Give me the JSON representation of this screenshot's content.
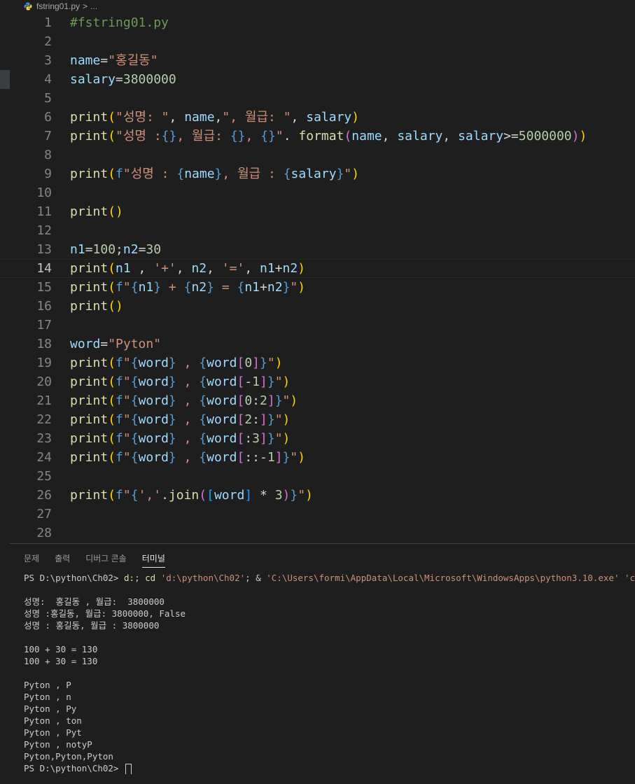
{
  "breadcrumb": {
    "file": "fstring01.py",
    "separator": ">",
    "trail": "..."
  },
  "editor": {
    "active_line": 14,
    "lines": [
      {
        "n": "1",
        "t": [
          [
            "c-comment",
            "#fstring01.py"
          ]
        ]
      },
      {
        "n": "2",
        "t": []
      },
      {
        "n": "3",
        "t": [
          [
            "c-var",
            "name"
          ],
          [
            "c-op",
            "="
          ],
          [
            "c-str",
            "\"홍길동\""
          ]
        ]
      },
      {
        "n": "4",
        "t": [
          [
            "c-var",
            "salary"
          ],
          [
            "c-op",
            "="
          ],
          [
            "c-num",
            "3800000"
          ]
        ]
      },
      {
        "n": "5",
        "t": []
      },
      {
        "n": "6",
        "t": [
          [
            "c-fn",
            "print"
          ],
          [
            "c-br1",
            "("
          ],
          [
            "c-str",
            "\"성명: \""
          ],
          [
            "c-op",
            ", "
          ],
          [
            "c-var",
            "name"
          ],
          [
            "c-op",
            ","
          ],
          [
            "c-str",
            "\", 월급: \""
          ],
          [
            "c-op",
            ", "
          ],
          [
            "c-var",
            "salary"
          ],
          [
            "c-br1",
            ")"
          ]
        ]
      },
      {
        "n": "7",
        "t": [
          [
            "c-fn",
            "print"
          ],
          [
            "c-br1",
            "("
          ],
          [
            "c-str",
            "\"성명 :"
          ],
          [
            "c-kw",
            "{}"
          ],
          [
            "c-str",
            ", 월급: "
          ],
          [
            "c-kw",
            "{}"
          ],
          [
            "c-str",
            ", "
          ],
          [
            "c-kw",
            "{}"
          ],
          [
            "c-str",
            "\""
          ],
          [
            "c-op",
            ". "
          ],
          [
            "c-fn",
            "format"
          ],
          [
            "c-br2",
            "("
          ],
          [
            "c-var",
            "name"
          ],
          [
            "c-op",
            ", "
          ],
          [
            "c-var",
            "salary"
          ],
          [
            "c-op",
            ", "
          ],
          [
            "c-var",
            "salary"
          ],
          [
            "c-op",
            ">="
          ],
          [
            "c-num",
            "5000000"
          ],
          [
            "c-br2",
            ")"
          ],
          [
            "c-br1",
            ")"
          ]
        ]
      },
      {
        "n": "8",
        "t": []
      },
      {
        "n": "9",
        "t": [
          [
            "c-fn",
            "print"
          ],
          [
            "c-br1",
            "("
          ],
          [
            "c-kw",
            "f"
          ],
          [
            "c-str",
            "\"성명 : "
          ],
          [
            "c-kw",
            "{"
          ],
          [
            "c-var",
            "name"
          ],
          [
            "c-kw",
            "}"
          ],
          [
            "c-str",
            ", 월급 : "
          ],
          [
            "c-kw",
            "{"
          ],
          [
            "c-var",
            "salary"
          ],
          [
            "c-kw",
            "}"
          ],
          [
            "c-str",
            "\""
          ],
          [
            "c-br1",
            ")"
          ]
        ]
      },
      {
        "n": "10",
        "t": []
      },
      {
        "n": "11",
        "t": [
          [
            "c-fn",
            "print"
          ],
          [
            "c-br1",
            "()"
          ]
        ]
      },
      {
        "n": "12",
        "t": []
      },
      {
        "n": "13",
        "t": [
          [
            "c-var",
            "n1"
          ],
          [
            "c-op",
            "="
          ],
          [
            "c-num",
            "100"
          ],
          [
            "c-op",
            ";"
          ],
          [
            "c-var",
            "n2"
          ],
          [
            "c-op",
            "="
          ],
          [
            "c-num",
            "30"
          ]
        ]
      },
      {
        "n": "14",
        "t": [
          [
            "c-fn",
            "print"
          ],
          [
            "c-br1",
            "("
          ],
          [
            "c-var",
            "n1"
          ],
          [
            "c-op",
            " , "
          ],
          [
            "c-str",
            "'+'"
          ],
          [
            "c-op",
            ", "
          ],
          [
            "c-var",
            "n2"
          ],
          [
            "c-op",
            ", "
          ],
          [
            "c-str",
            "'='"
          ],
          [
            "c-op",
            ", "
          ],
          [
            "c-var",
            "n1"
          ],
          [
            "c-op",
            "+"
          ],
          [
            "c-var",
            "n2"
          ],
          [
            "c-br1",
            ")"
          ]
        ]
      },
      {
        "n": "15",
        "t": [
          [
            "c-fn",
            "print"
          ],
          [
            "c-br1",
            "("
          ],
          [
            "c-kw",
            "f"
          ],
          [
            "c-str",
            "\""
          ],
          [
            "c-kw",
            "{"
          ],
          [
            "c-var",
            "n1"
          ],
          [
            "c-kw",
            "}"
          ],
          [
            "c-str",
            " + "
          ],
          [
            "c-kw",
            "{"
          ],
          [
            "c-var",
            "n2"
          ],
          [
            "c-kw",
            "}"
          ],
          [
            "c-str",
            " = "
          ],
          [
            "c-kw",
            "{"
          ],
          [
            "c-var",
            "n1"
          ],
          [
            "c-op",
            "+"
          ],
          [
            "c-var",
            "n2"
          ],
          [
            "c-kw",
            "}"
          ],
          [
            "c-str",
            "\""
          ],
          [
            "c-br1",
            ")"
          ]
        ]
      },
      {
        "n": "16",
        "t": [
          [
            "c-fn",
            "print"
          ],
          [
            "c-br1",
            "()"
          ]
        ]
      },
      {
        "n": "17",
        "t": []
      },
      {
        "n": "18",
        "t": [
          [
            "c-var",
            "word"
          ],
          [
            "c-op",
            "="
          ],
          [
            "c-str",
            "\"Pyton\""
          ]
        ]
      },
      {
        "n": "19",
        "t": [
          [
            "c-fn",
            "print"
          ],
          [
            "c-br1",
            "("
          ],
          [
            "c-kw",
            "f"
          ],
          [
            "c-str",
            "\""
          ],
          [
            "c-kw",
            "{"
          ],
          [
            "c-var",
            "word"
          ],
          [
            "c-kw",
            "}"
          ],
          [
            "c-str",
            " , "
          ],
          [
            "c-kw",
            "{"
          ],
          [
            "c-var",
            "word"
          ],
          [
            "c-br2",
            "["
          ],
          [
            "c-num",
            "0"
          ],
          [
            "c-br2",
            "]"
          ],
          [
            "c-kw",
            "}"
          ],
          [
            "c-str",
            "\""
          ],
          [
            "c-br1",
            ")"
          ]
        ]
      },
      {
        "n": "20",
        "t": [
          [
            "c-fn",
            "print"
          ],
          [
            "c-br1",
            "("
          ],
          [
            "c-kw",
            "f"
          ],
          [
            "c-str",
            "\""
          ],
          [
            "c-kw",
            "{"
          ],
          [
            "c-var",
            "word"
          ],
          [
            "c-kw",
            "}"
          ],
          [
            "c-str",
            " , "
          ],
          [
            "c-kw",
            "{"
          ],
          [
            "c-var",
            "word"
          ],
          [
            "c-br2",
            "["
          ],
          [
            "c-op",
            "-"
          ],
          [
            "c-num",
            "1"
          ],
          [
            "c-br2",
            "]"
          ],
          [
            "c-kw",
            "}"
          ],
          [
            "c-str",
            "\""
          ],
          [
            "c-br1",
            ")"
          ]
        ]
      },
      {
        "n": "21",
        "t": [
          [
            "c-fn",
            "print"
          ],
          [
            "c-br1",
            "("
          ],
          [
            "c-kw",
            "f"
          ],
          [
            "c-str",
            "\""
          ],
          [
            "c-kw",
            "{"
          ],
          [
            "c-var",
            "word"
          ],
          [
            "c-kw",
            "}"
          ],
          [
            "c-str",
            " , "
          ],
          [
            "c-kw",
            "{"
          ],
          [
            "c-var",
            "word"
          ],
          [
            "c-br2",
            "["
          ],
          [
            "c-num",
            "0"
          ],
          [
            "c-op",
            ":"
          ],
          [
            "c-num",
            "2"
          ],
          [
            "c-br2",
            "]"
          ],
          [
            "c-kw",
            "}"
          ],
          [
            "c-str",
            "\""
          ],
          [
            "c-br1",
            ")"
          ]
        ]
      },
      {
        "n": "22",
        "t": [
          [
            "c-fn",
            "print"
          ],
          [
            "c-br1",
            "("
          ],
          [
            "c-kw",
            "f"
          ],
          [
            "c-str",
            "\""
          ],
          [
            "c-kw",
            "{"
          ],
          [
            "c-var",
            "word"
          ],
          [
            "c-kw",
            "}"
          ],
          [
            "c-str",
            " , "
          ],
          [
            "c-kw",
            "{"
          ],
          [
            "c-var",
            "word"
          ],
          [
            "c-br2",
            "["
          ],
          [
            "c-num",
            "2"
          ],
          [
            "c-op",
            ":"
          ],
          [
            "c-br2",
            "]"
          ],
          [
            "c-kw",
            "}"
          ],
          [
            "c-str",
            "\""
          ],
          [
            "c-br1",
            ")"
          ]
        ]
      },
      {
        "n": "23",
        "t": [
          [
            "c-fn",
            "print"
          ],
          [
            "c-br1",
            "("
          ],
          [
            "c-kw",
            "f"
          ],
          [
            "c-str",
            "\""
          ],
          [
            "c-kw",
            "{"
          ],
          [
            "c-var",
            "word"
          ],
          [
            "c-kw",
            "}"
          ],
          [
            "c-str",
            " , "
          ],
          [
            "c-kw",
            "{"
          ],
          [
            "c-var",
            "word"
          ],
          [
            "c-br2",
            "["
          ],
          [
            "c-op",
            ":"
          ],
          [
            "c-num",
            "3"
          ],
          [
            "c-br2",
            "]"
          ],
          [
            "c-kw",
            "}"
          ],
          [
            "c-str",
            "\""
          ],
          [
            "c-br1",
            ")"
          ]
        ]
      },
      {
        "n": "24",
        "t": [
          [
            "c-fn",
            "print"
          ],
          [
            "c-br1",
            "("
          ],
          [
            "c-kw",
            "f"
          ],
          [
            "c-str",
            "\""
          ],
          [
            "c-kw",
            "{"
          ],
          [
            "c-var",
            "word"
          ],
          [
            "c-kw",
            "}"
          ],
          [
            "c-str",
            " , "
          ],
          [
            "c-kw",
            "{"
          ],
          [
            "c-var",
            "word"
          ],
          [
            "c-br2",
            "["
          ],
          [
            "c-op",
            "::-"
          ],
          [
            "c-num",
            "1"
          ],
          [
            "c-br2",
            "]"
          ],
          [
            "c-kw",
            "}"
          ],
          [
            "c-str",
            "\""
          ],
          [
            "c-br1",
            ")"
          ]
        ]
      },
      {
        "n": "25",
        "t": []
      },
      {
        "n": "26",
        "t": [
          [
            "c-fn",
            "print"
          ],
          [
            "c-br1",
            "("
          ],
          [
            "c-kw",
            "f"
          ],
          [
            "c-str",
            "\""
          ],
          [
            "c-kw",
            "{"
          ],
          [
            "c-str",
            "','"
          ],
          [
            "c-op",
            "."
          ],
          [
            "c-fn",
            "join"
          ],
          [
            "c-br2",
            "("
          ],
          [
            "c-br3",
            "["
          ],
          [
            "c-var",
            "word"
          ],
          [
            "c-br3",
            "]"
          ],
          [
            "c-op",
            " * "
          ],
          [
            "c-num",
            "3"
          ],
          [
            "c-br2",
            ")"
          ],
          [
            "c-kw",
            "}"
          ],
          [
            "c-str",
            "\""
          ],
          [
            "c-br1",
            ")"
          ]
        ]
      },
      {
        "n": "27",
        "t": []
      },
      {
        "n": "28",
        "t": []
      }
    ]
  },
  "panel": {
    "tabs": [
      {
        "label": "문제",
        "active": false
      },
      {
        "label": "출력",
        "active": false
      },
      {
        "label": "디버그 콘솔",
        "active": false
      },
      {
        "label": "터미널",
        "active": true
      }
    ],
    "terminal": {
      "command": {
        "prompt": "PS D:\\python\\Ch02> ",
        "segments": [
          [
            "t-cmd",
            "d:"
          ],
          [
            "",
            "; "
          ],
          [
            "t-cmd",
            "cd"
          ],
          [
            "",
            " "
          ],
          [
            "t-str",
            "'d:\\python\\Ch02'"
          ],
          [
            "",
            "; & "
          ],
          [
            "t-str",
            "'C:\\Users\\formi\\AppData\\Local\\Microsoft\\WindowsApps\\python3.10.exe'"
          ],
          [
            "",
            " "
          ],
          [
            "t-str",
            "'c:\\Users\\formi\\.vscode\\extensions\\ms-python.python\\pythonFiles\\lib\\python\\debugpy\\launcher'"
          ]
        ]
      },
      "output": [
        "",
        "성명:  홍길동 , 월급:  3800000",
        "성명 :홍길동, 월급: 3800000, False",
        "성명 : 홍길동, 월급 : 3800000",
        "",
        "100 + 30 = 130",
        "100 + 30 = 130",
        "",
        "Pyton , P",
        "Pyton , n",
        "Pyton , Py",
        "Pyton , ton",
        "Pyton , Pyt",
        "Pyton , notyP",
        "Pyton,Pyton,Pyton"
      ],
      "final_prompt": "PS D:\\python\\Ch02> "
    }
  },
  "colors": {
    "background": "#1e1e1e",
    "line_number": "#858585",
    "string": "#ce9178",
    "variable": "#9cdcfe",
    "function": "#dcdcaa",
    "number": "#b5cea8",
    "comment": "#6a9955"
  }
}
